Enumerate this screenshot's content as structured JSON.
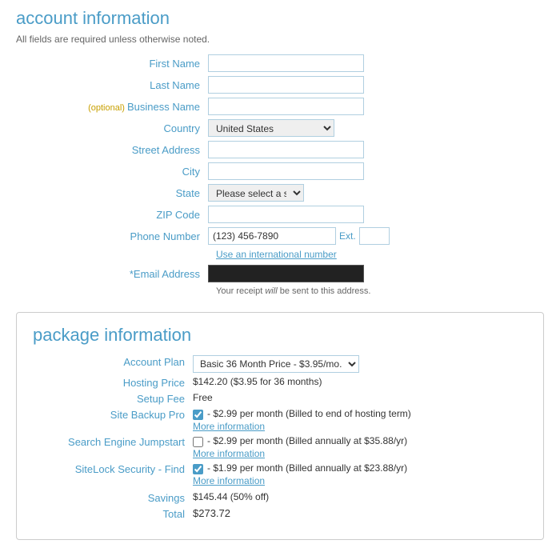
{
  "account": {
    "title": "account information",
    "subtitle": "All fields are required unless otherwise noted.",
    "fields": {
      "first_name_label": "First Name",
      "last_name_label": "Last Name",
      "business_name_label": "Business Name",
      "optional_label": "(optional)",
      "country_label": "Country",
      "street_address_label": "Street Address",
      "city_label": "City",
      "state_label": "State",
      "zip_code_label": "ZIP Code",
      "phone_number_label": "Phone Number",
      "phone_value": "(123) 456-7890",
      "ext_label": "Ext.",
      "intl_link": "Use an international number",
      "email_label": "*Email Address",
      "email_note_pre": "Your receipt ",
      "email_note_em": "will",
      "email_note_post": " be sent to this address.",
      "country_default": "United States",
      "state_default": "Please select a state"
    }
  },
  "package": {
    "title": "package information",
    "rows": {
      "account_plan_label": "Account Plan",
      "account_plan_option": "Basic 36 Month Price - $3.95/mo.",
      "hosting_price_label": "Hosting Price",
      "hosting_price_value": "$142.20  ($3.95 for 36 months)",
      "setup_fee_label": "Setup Fee",
      "setup_fee_value": "Free",
      "site_backup_label": "Site Backup Pro",
      "site_backup_value": "- $2.99 per month (Billed to end of hosting term)",
      "site_backup_more": "More information",
      "search_engine_label": "Search Engine Jumpstart",
      "search_engine_value": "- $2.99 per month (Billed annually at $35.88/yr)",
      "search_engine_more": "More information",
      "sitelock_label": "SiteLock Security - Find",
      "sitelock_value": "- $1.99 per month (Billed annually at $23.88/yr)",
      "sitelock_more": "More information",
      "savings_label": "Savings",
      "savings_value": "$145.44 (50% off)",
      "total_label": "Total",
      "total_value": "$273.72"
    }
  }
}
